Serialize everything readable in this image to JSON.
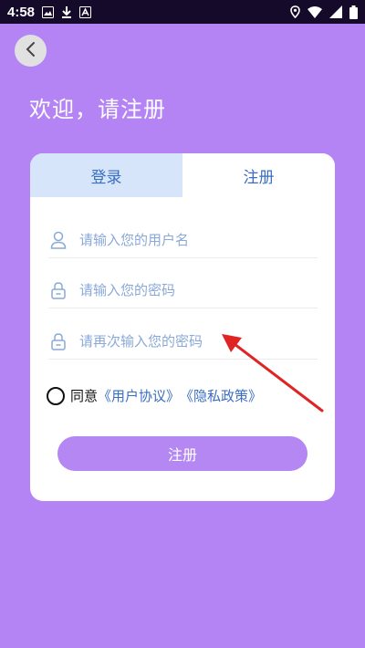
{
  "status_bar": {
    "time": "4:58",
    "left_icons": [
      "image-icon",
      "download-icon",
      "app-icon"
    ],
    "right_icons": [
      "location-icon",
      "wifi-icon",
      "signal-icon",
      "battery-icon"
    ]
  },
  "header": {
    "back_icon": "chevron-left-icon",
    "welcome_text": "欢迎，请注册"
  },
  "tabs": [
    {
      "label": "登录",
      "active": false
    },
    {
      "label": "注册",
      "active": true
    }
  ],
  "form": {
    "username_placeholder": "请输入您的用户名",
    "password_placeholder": "请输入您的密码",
    "confirm_placeholder": "请再次输入您的密码"
  },
  "agreement": {
    "prefix": "同意",
    "user_agreement": "《用户协议》",
    "privacy_policy": "《隐私政策》",
    "checked": false
  },
  "submit_label": "注册",
  "colors": {
    "background": "#b484f5",
    "accent": "#3a6ec2",
    "button": "#b487f2",
    "tab_inactive": "#d7e5fa",
    "annotation_arrow": "#e02424"
  }
}
